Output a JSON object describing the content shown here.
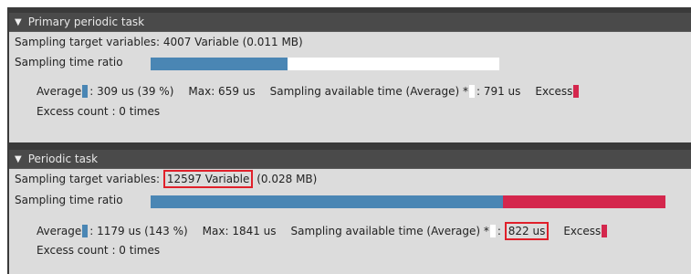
{
  "primary": {
    "header": "Primary periodic task",
    "target_label": "Sampling target variables",
    "target_value": "4007 Variable",
    "target_size": "(0.011 MB)",
    "ratio_label": "Sampling time ratio",
    "ratio_progress": {
      "used_percent": 39,
      "excess_percent": 0
    },
    "average_label": "Average",
    "average_value": ": 309 us (39 %)",
    "max_label": "Max",
    "max_value": ": 659 us",
    "available_label": "Sampling available time (Average) *",
    "available_value": ": 791 us",
    "excess_label": "Excess",
    "excess_count": "Excess count : 0 times"
  },
  "periodic": {
    "header": "Periodic task",
    "target_label": "Sampling target variables",
    "target_value": "12597 Variable",
    "target_size": "(0.028 MB)",
    "ratio_label": "Sampling time ratio",
    "ratio_progress": {
      "used_percent": 143,
      "excess_percent": 43
    },
    "average_label": "Average",
    "average_value": ": 1179 us (143 %)",
    "max_label": "Max",
    "max_value": ": 1841 us",
    "available_label": "Sampling available time (Average) *",
    "available_value": "822 us",
    "excess_label": "Excess",
    "excess_count": "Excess count : 0 times"
  },
  "colors": {
    "used": "#4a86b4",
    "available": "#ffffff",
    "excess": "#d4274d",
    "highlight": "#e0202a"
  }
}
